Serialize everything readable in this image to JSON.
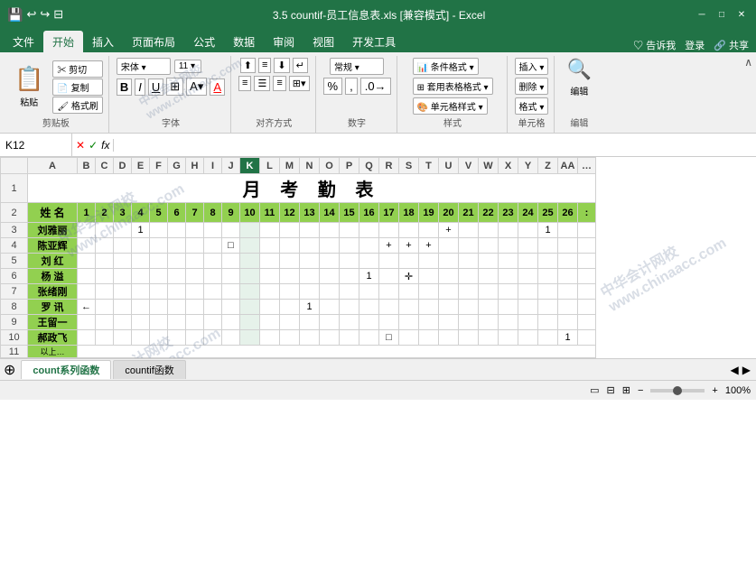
{
  "titleBar": {
    "title": "3.5 countif-员工信息表.xls [兼容模式] - Excel",
    "saveIcon": "💾",
    "undoIcon": "↩",
    "redoIcon": "↪",
    "layoutIcon": "⊟"
  },
  "ribbonTabs": [
    "文件",
    "开始",
    "插入",
    "页面布局",
    "公式",
    "数据",
    "审阅",
    "视图",
    "开发工具"
  ],
  "activeTab": "开始",
  "ribbonRight": [
    "♡告诉我",
    "登录",
    "共享"
  ],
  "nameBox": "K12",
  "groups": {
    "clipboard": "剪贴板",
    "font": "字体",
    "alignment": "对齐方式",
    "number": "数字",
    "style": "样式",
    "cell": "单元格",
    "edit": "编辑"
  },
  "styleButtons": [
    "条件格式·",
    "套用表格格式·",
    "单元格样式·"
  ],
  "sheet": {
    "title": "月 考 勤 表",
    "colHeaders": [
      "A",
      "B",
      "C",
      "D",
      "E",
      "F",
      "G",
      "H",
      "I",
      "J",
      "K",
      "L",
      "M",
      "N",
      "O",
      "P",
      "Q",
      "R",
      "S",
      "T",
      "U",
      "V",
      "W",
      "X",
      "Y",
      "Z",
      "AA"
    ],
    "row2Headers": [
      "姓 名",
      "1",
      "2",
      "3",
      "4",
      "5",
      "6",
      "7",
      "8",
      "9",
      "10",
      "11",
      "12",
      "13",
      "14",
      "15",
      "16",
      "17",
      "18",
      "19",
      "20",
      "21",
      "22",
      "23",
      "24",
      "25",
      "26"
    ],
    "rows": [
      {
        "num": 1,
        "title": "月 考 勤 表",
        "span": 28
      },
      {
        "num": 2,
        "isHeader": true
      },
      {
        "num": 3,
        "name": "刘雅丽",
        "data": {
          "E": "1",
          "U": "+",
          "Z": "1"
        }
      },
      {
        "num": 4,
        "name": "陈亚辉",
        "data": {
          "J": "□",
          "R": "+",
          "S": "+",
          "T": "+"
        }
      },
      {
        "num": 5,
        "name": "刘  红",
        "data": {}
      },
      {
        "num": 6,
        "name": "杨  溢",
        "data": {
          "Q": "1",
          "S": "✛"
        }
      },
      {
        "num": 7,
        "name": "张绪刚",
        "data": {}
      },
      {
        "num": 8,
        "name": "罗  讯",
        "data": {
          "N": "1"
        }
      },
      {
        "num": 9,
        "name": "王留一",
        "data": {}
      },
      {
        "num": 10,
        "name": "郝政飞",
        "data": {
          "R": "□",
          "AA": "1"
        }
      }
    ]
  },
  "sheetTabs": [
    "count系列函数",
    "countif函数"
  ],
  "activeSheet": "count系列函数",
  "bottomBar": {
    "left": "",
    "right": ""
  }
}
